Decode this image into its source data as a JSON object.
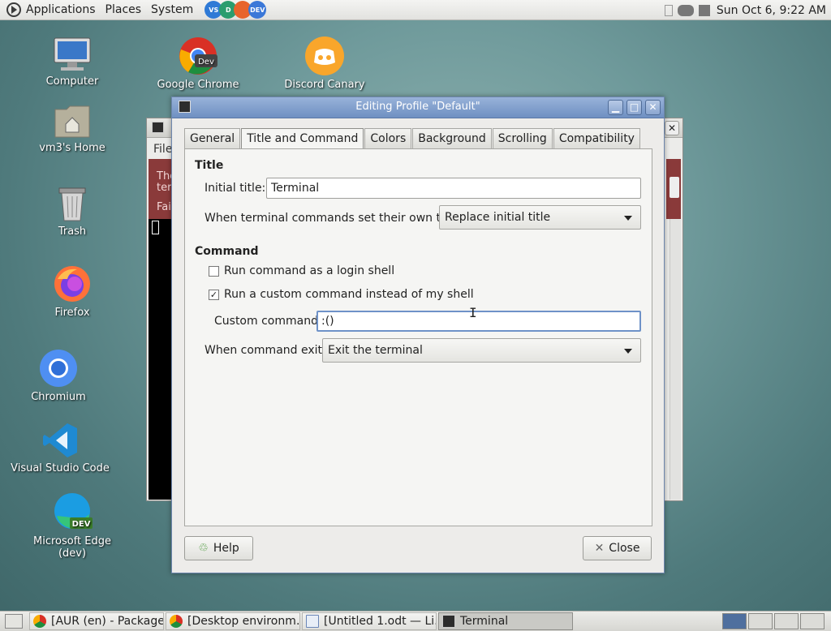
{
  "top_panel": {
    "menus": [
      "Applications",
      "Places",
      "System"
    ],
    "launchers": [
      {
        "icon": "vscode-icon",
        "color": "#2f7ad6"
      },
      {
        "icon": "edge-dev-icon",
        "color": "#2b9d6e"
      },
      {
        "icon": "firefox-icon",
        "color": "#e8642c"
      },
      {
        "icon": "chrome-dev-icon",
        "color": "#3b78d8"
      }
    ],
    "clock": "Sun Oct  6,  9:22 AM"
  },
  "desktop": {
    "icons": [
      {
        "label": "Computer",
        "icon": "computer-icon"
      },
      {
        "label": "Google Chrome",
        "icon": "chrome-dev-icon"
      },
      {
        "label": "Discord Canary",
        "icon": "discord-icon"
      },
      {
        "label": "vm3's Home",
        "icon": "home-folder-icon"
      },
      {
        "label": "Trash",
        "icon": "trash-icon"
      },
      {
        "label": "Firefox",
        "icon": "firefox-icon"
      },
      {
        "label": "Chromium",
        "icon": "chromium-icon"
      },
      {
        "label": "Visual Studio Code",
        "icon": "vscode-icon"
      },
      {
        "label": "Microsoft Edge (dev)",
        "icon": "edge-dev-icon"
      }
    ]
  },
  "terminal_bg": {
    "menu_partial": "File",
    "red_text": [
      "The",
      "term",
      "Fai"
    ]
  },
  "dialog": {
    "title": "Editing Profile \"Default\"",
    "tabs": [
      "General",
      "Title and Command",
      "Colors",
      "Background",
      "Scrolling",
      "Compatibility"
    ],
    "active_tab": "Title and Command",
    "title_section": {
      "heading": "Title",
      "initial_title_label": "Initial title:",
      "initial_title_value": "Terminal",
      "own_titles_label": "When terminal commands set their own titles:",
      "own_titles_value": "Replace initial title"
    },
    "command_section": {
      "heading": "Command",
      "login_shell_label": "Run command as a login shell",
      "login_shell_checked": false,
      "custom_cmd_label": "Run a custom command instead of my shell",
      "custom_cmd_checked": true,
      "custom_command_label": "Custom command:",
      "custom_command_value": ":()",
      "exit_label": "When command exits:",
      "exit_value": "Exit the terminal"
    },
    "help_label": "Help",
    "close_label": "Close",
    "check_mark": "✓"
  },
  "taskbar": {
    "tasks": [
      {
        "label": "[AUR (en) - Package…",
        "icon": "chrome-icon"
      },
      {
        "label": "[Desktop environm…",
        "icon": "chrome-icon"
      },
      {
        "label": "[Untitled 1.odt — Li…",
        "icon": "document-icon"
      },
      {
        "label": "Terminal",
        "icon": "terminal-icon"
      }
    ]
  }
}
